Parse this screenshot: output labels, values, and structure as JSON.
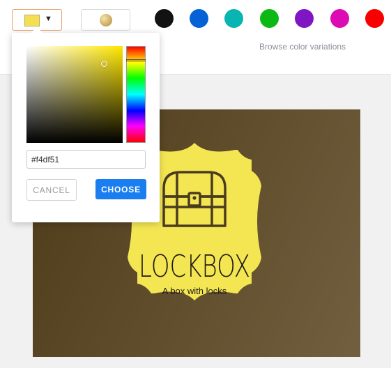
{
  "toolbar": {
    "selected_color": "#f4df51",
    "dropdown_caret": "▼",
    "preset_colors": [
      "#121212",
      "#0562d6",
      "#09b5b3",
      "#0cb814",
      "#8015c4",
      "#dc0bb3",
      "#f90000"
    ],
    "browse_label": "Browse color variations"
  },
  "picker": {
    "hex_value": "#f4df51",
    "cancel_label": "CANCEL",
    "choose_label": "CHOOSE"
  },
  "design": {
    "background_colors": [
      "#4d3b18",
      "#715f3f"
    ],
    "badge_color": "#f4e652",
    "ink_color": "#4a3b20",
    "icon": "treasure-chest-icon",
    "title": "LOCKBOX",
    "tagline": "A box with locks"
  }
}
